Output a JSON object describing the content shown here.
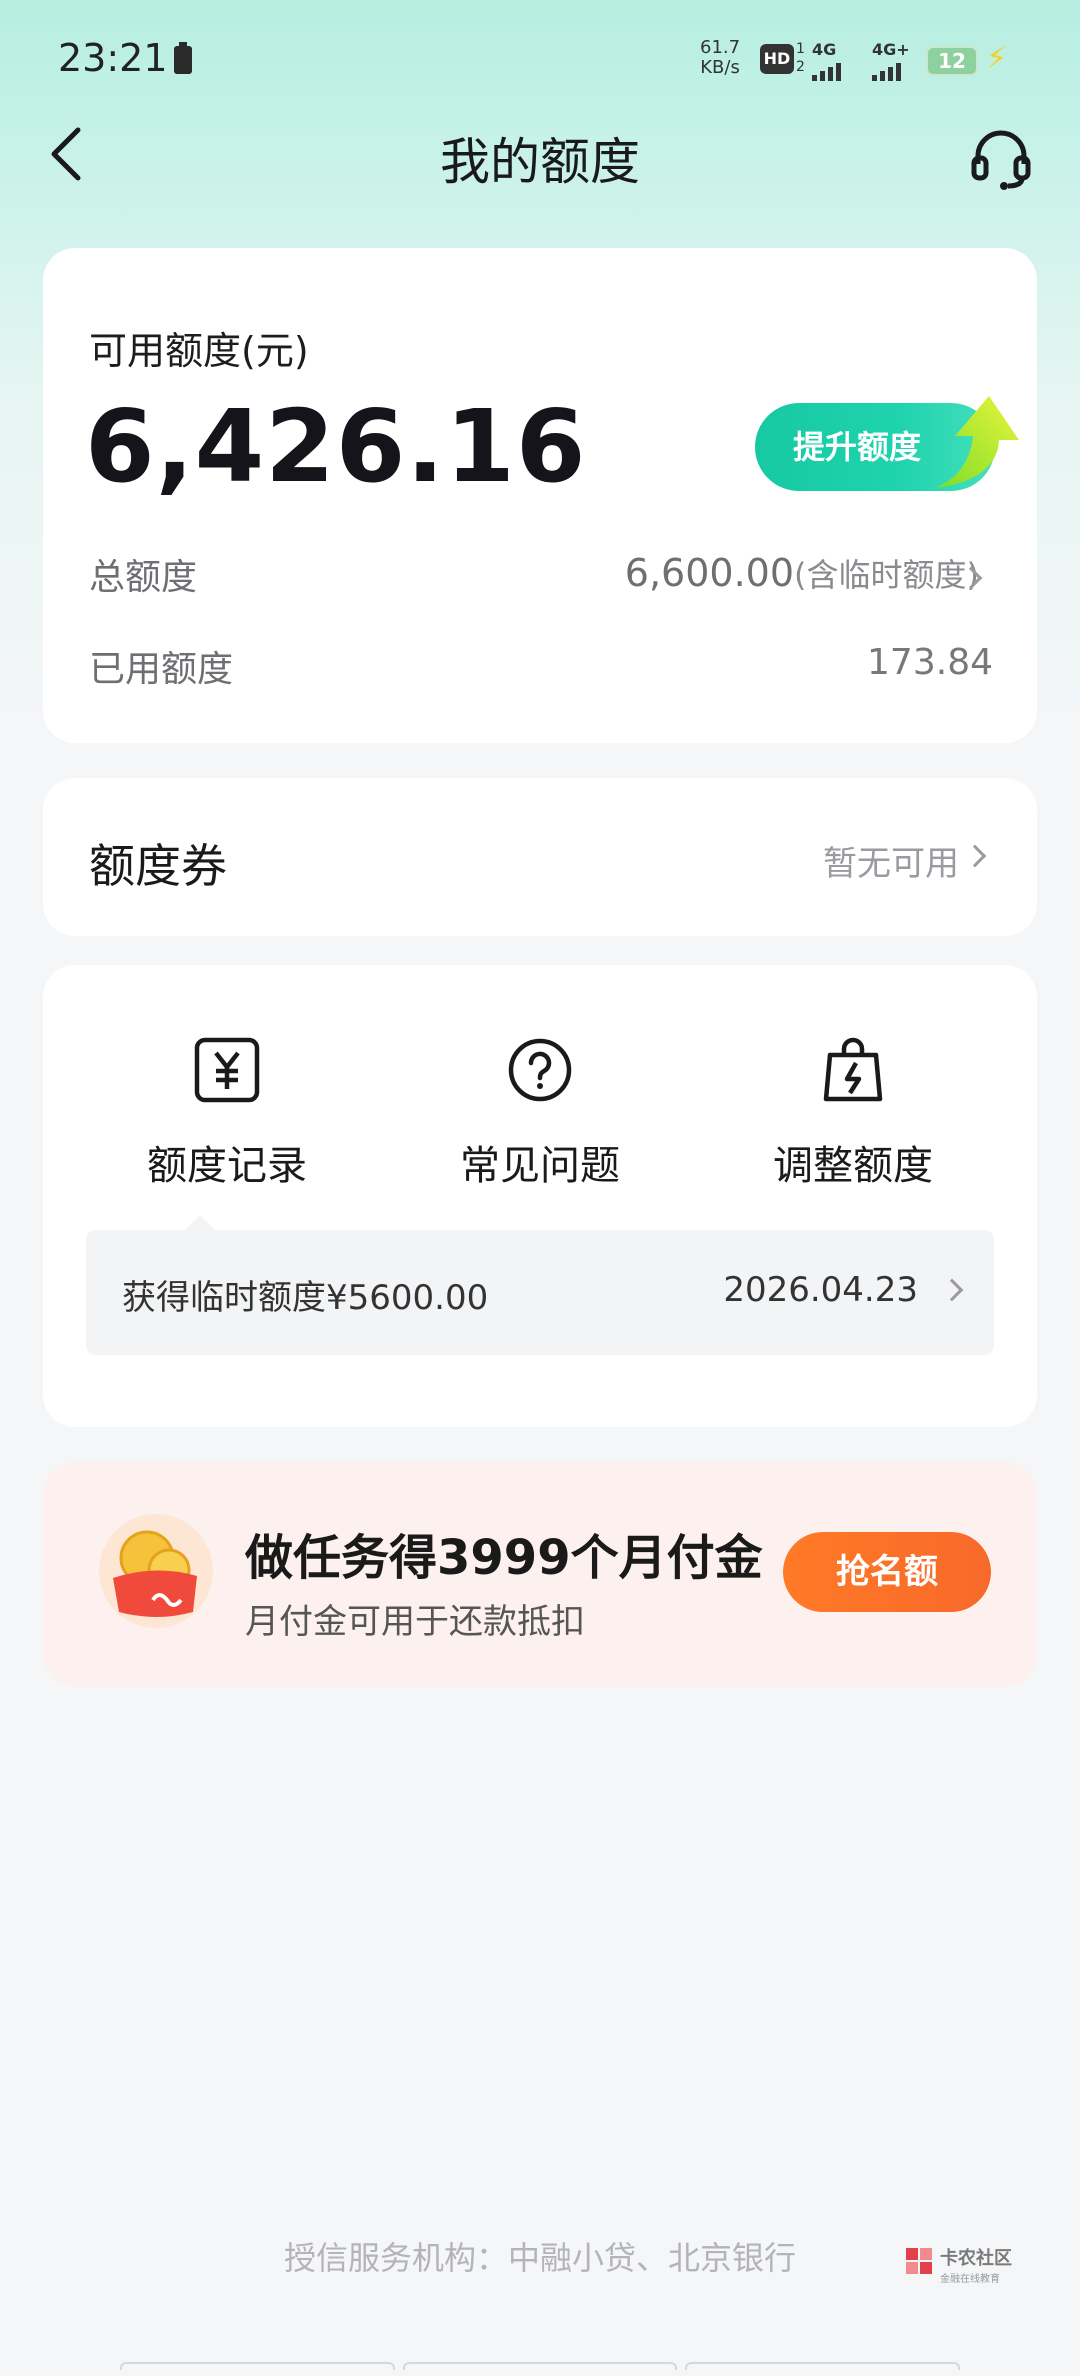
{
  "status_bar": {
    "time": "23:21",
    "net_speed_value": "61.7",
    "net_speed_unit": "KB/s",
    "hd_label": "HD",
    "hd_sub_top": "1",
    "hd_sub_bottom": "2",
    "signal1_label": "4G",
    "signal2_label": "4G+",
    "battery_level": "12"
  },
  "header": {
    "title": "我的额度",
    "back_icon": "chevron-left-icon",
    "service_icon": "headset-icon"
  },
  "quota": {
    "available_label": "可用额度(元)",
    "available_amount": "6,426.16",
    "raise_button": "提升额度",
    "total_label": "总额度",
    "total_amount": "6,600.00",
    "total_note": "(含临时额度)",
    "used_label": "已用额度",
    "used_amount": "173.84"
  },
  "coupon": {
    "title": "额度券",
    "status": "暂无可用"
  },
  "actions": [
    {
      "label": "额度记录",
      "icon": "yuan-receipt-icon"
    },
    {
      "label": "常见问题",
      "icon": "question-circle-icon"
    },
    {
      "label": "调整额度",
      "icon": "lightning-bag-icon"
    }
  ],
  "record": {
    "text": "获得临时额度¥5600.00",
    "date": "2026.04.23"
  },
  "promo": {
    "title": "做任务得3999个月付金",
    "subtitle": "月付金可用于还款抵扣",
    "button": "抢名额",
    "icon": "coin-wallet-icon"
  },
  "footer": {
    "note": "授信服务机构：中融小贷、北京银行"
  },
  "watermark": {
    "title": "卡农社区",
    "subtitle": "金融在线教育"
  },
  "colors": {
    "accent_green": "#16c9a2",
    "promo_orange": "#f8692a",
    "header_mint": "#b6eee0"
  }
}
